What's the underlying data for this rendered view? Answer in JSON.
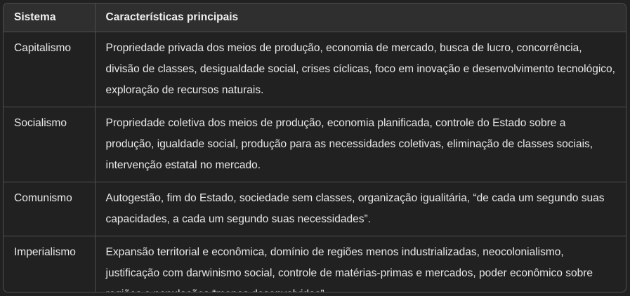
{
  "table": {
    "headers": [
      "Sistema",
      "Características principais"
    ],
    "rows": [
      {
        "sistema": "Capitalismo",
        "caracteristicas": "Propriedade privada dos meios de produção, economia de mercado, busca de lucro, concorrência, divisão de classes, desigualdade social, crises cíclicas, foco em inovação e desenvolvimento tecnológico, exploração de recursos naturais."
      },
      {
        "sistema": "Socialismo",
        "caracteristicas": "Propriedade coletiva dos meios de produção, economia planificada, controle do Estado sobre a produção, igualdade social, produção para as necessidades coletivas, eliminação de classes sociais, intervenção estatal no mercado."
      },
      {
        "sistema": "Comunismo",
        "caracteristicas": "Autogestão, fim do Estado, sociedade sem classes, organização igualitária, “de cada um segundo suas capacidades, a cada um segundo suas necessidades”."
      },
      {
        "sistema": "Imperialismo",
        "caracteristicas": "Expansão territorial e econômica, domínio de regiões menos industrializadas, neocolonialismo, justificação com darwinismo social, controle de matérias-primas e mercados, poder econômico sobre regiões e populações “menos desenvolvidas”."
      }
    ]
  }
}
